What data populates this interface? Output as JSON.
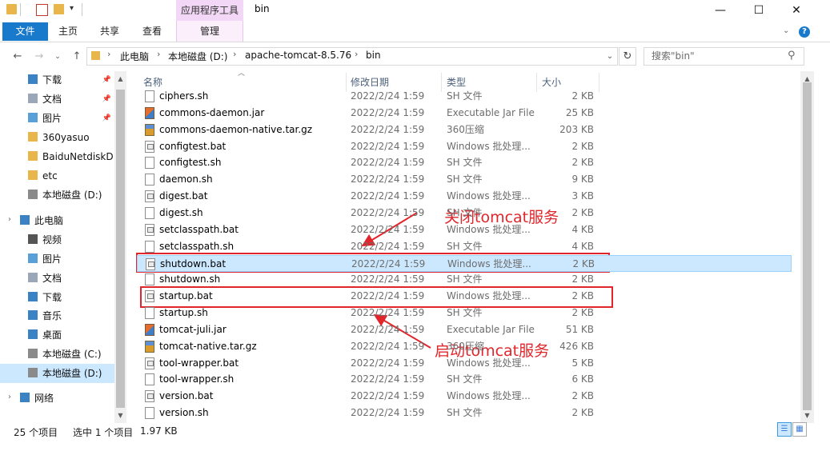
{
  "window": {
    "title": "bin",
    "context_group": "应用程序工具",
    "controls": {
      "minimize": "—",
      "maximize": "☐",
      "close": "✕"
    }
  },
  "ribbon": {
    "tabs": [
      "文件",
      "主页",
      "共享",
      "查看",
      "管理"
    ],
    "help": "?"
  },
  "address": {
    "breadcrumbs": [
      "此电脑",
      "本地磁盘 (D:)",
      "apache-tomcat-8.5.76",
      "bin"
    ],
    "search_placeholder": "搜索\"bin\""
  },
  "nav_pane": {
    "items": [
      {
        "label": "下载",
        "icon": "download-folder-icon",
        "pinned": true
      },
      {
        "label": "文档",
        "icon": "documents-folder-icon",
        "pinned": true
      },
      {
        "label": "图片",
        "icon": "pictures-folder-icon",
        "pinned": true
      },
      {
        "label": "360yasuo",
        "icon": "folder-icon",
        "pinned": false
      },
      {
        "label": "BaiduNetdiskD",
        "icon": "folder-icon",
        "pinned": false
      },
      {
        "label": "etc",
        "icon": "folder-icon",
        "pinned": false
      },
      {
        "label": "本地磁盘 (D:)",
        "icon": "drive-icon",
        "pinned": false
      },
      {
        "label": "此电脑",
        "icon": "this-pc-icon",
        "pinned": false
      },
      {
        "label": "视频",
        "icon": "videos-folder-icon",
        "pinned": false
      },
      {
        "label": "图片",
        "icon": "pictures-folder-icon",
        "pinned": false
      },
      {
        "label": "文档",
        "icon": "documents-folder-icon",
        "pinned": false
      },
      {
        "label": "下载",
        "icon": "download-folder-icon",
        "pinned": false
      },
      {
        "label": "音乐",
        "icon": "music-folder-icon",
        "pinned": false
      },
      {
        "label": "桌面",
        "icon": "desktop-folder-icon",
        "pinned": false
      },
      {
        "label": "本地磁盘 (C:)",
        "icon": "drive-icon",
        "pinned": false
      },
      {
        "label": "本地磁盘 (D:)",
        "icon": "drive-icon",
        "pinned": false,
        "selected": true
      },
      {
        "label": "网络",
        "icon": "network-icon",
        "pinned": false
      }
    ]
  },
  "columns": {
    "name": "名称",
    "date": "修改日期",
    "type": "类型",
    "size": "大小"
  },
  "files": [
    {
      "name": "ciphers.sh",
      "date": "2022/2/24 1:59",
      "type": "SH 文件",
      "size": "2 KB",
      "icon": "sh"
    },
    {
      "name": "commons-daemon.jar",
      "date": "2022/2/24 1:59",
      "type": "Executable Jar File",
      "size": "25 KB",
      "icon": "jar"
    },
    {
      "name": "commons-daemon-native.tar.gz",
      "date": "2022/2/24 1:59",
      "type": "360压缩",
      "size": "203 KB",
      "icon": "gz"
    },
    {
      "name": "configtest.bat",
      "date": "2022/2/24 1:59",
      "type": "Windows 批处理...",
      "size": "2 KB",
      "icon": "bat"
    },
    {
      "name": "configtest.sh",
      "date": "2022/2/24 1:59",
      "type": "SH 文件",
      "size": "2 KB",
      "icon": "sh"
    },
    {
      "name": "daemon.sh",
      "date": "2022/2/24 1:59",
      "type": "SH 文件",
      "size": "9 KB",
      "icon": "sh"
    },
    {
      "name": "digest.bat",
      "date": "2022/2/24 1:59",
      "type": "Windows 批处理...",
      "size": "3 KB",
      "icon": "bat"
    },
    {
      "name": "digest.sh",
      "date": "2022/2/24 1:59",
      "type": "SH 文件",
      "size": "2 KB",
      "icon": "sh"
    },
    {
      "name": "setclasspath.bat",
      "date": "2022/2/24 1:59",
      "type": "Windows 批处理...",
      "size": "4 KB",
      "icon": "bat"
    },
    {
      "name": "setclasspath.sh",
      "date": "2022/2/24 1:59",
      "type": "SH 文件",
      "size": "4 KB",
      "icon": "sh"
    },
    {
      "name": "shutdown.bat",
      "date": "2022/2/24 1:59",
      "type": "Windows 批处理...",
      "size": "2 KB",
      "icon": "bat",
      "selected": true
    },
    {
      "name": "shutdown.sh",
      "date": "2022/2/24 1:59",
      "type": "SH 文件",
      "size": "2 KB",
      "icon": "sh"
    },
    {
      "name": "startup.bat",
      "date": "2022/2/24 1:59",
      "type": "Windows 批处理...",
      "size": "2 KB",
      "icon": "bat"
    },
    {
      "name": "startup.sh",
      "date": "2022/2/24 1:59",
      "type": "SH 文件",
      "size": "2 KB",
      "icon": "sh"
    },
    {
      "name": "tomcat-juli.jar",
      "date": "2022/2/24 1:59",
      "type": "Executable Jar File",
      "size": "51 KB",
      "icon": "jar"
    },
    {
      "name": "tomcat-native.tar.gz",
      "date": "2022/2/24 1:59",
      "type": "360压缩",
      "size": "426 KB",
      "icon": "gz"
    },
    {
      "name": "tool-wrapper.bat",
      "date": "2022/2/24 1:59",
      "type": "Windows 批处理...",
      "size": "5 KB",
      "icon": "bat"
    },
    {
      "name": "tool-wrapper.sh",
      "date": "2022/2/24 1:59",
      "type": "SH 文件",
      "size": "6 KB",
      "icon": "sh"
    },
    {
      "name": "version.bat",
      "date": "2022/2/24 1:59",
      "type": "Windows 批处理...",
      "size": "2 KB",
      "icon": "bat"
    },
    {
      "name": "version.sh",
      "date": "2022/2/24 1:59",
      "type": "SH 文件",
      "size": "2 KB",
      "icon": "sh"
    }
  ],
  "status": {
    "count": "25 个项目",
    "selection": "选中 1 个项目",
    "size": "1.97 KB"
  },
  "annotations": {
    "shutdown": "关闭tomcat服务",
    "startup": "启动tomcat服务",
    "color": "#e0262b"
  }
}
